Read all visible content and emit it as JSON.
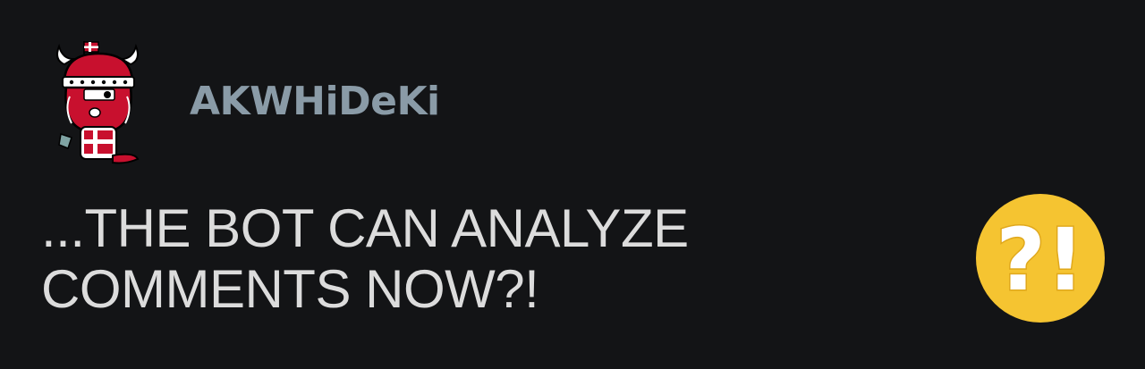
{
  "comment": {
    "author": "AKWHiDeKi",
    "text_line_1": "...THE BOT CAN ANALYZE",
    "text_line_2": "COMMENTS NOW?!",
    "avatar_icon": "viking-mascot-icon",
    "reaction_icon": "interrobang-emoji-icon"
  },
  "colors": {
    "background": "#131416",
    "author": "#8a9ba7",
    "text": "#dcdcdc",
    "emoji_fill": "#f5c431",
    "emoji_glyph": "#ffffff",
    "avatar_red": "#c8102e"
  }
}
